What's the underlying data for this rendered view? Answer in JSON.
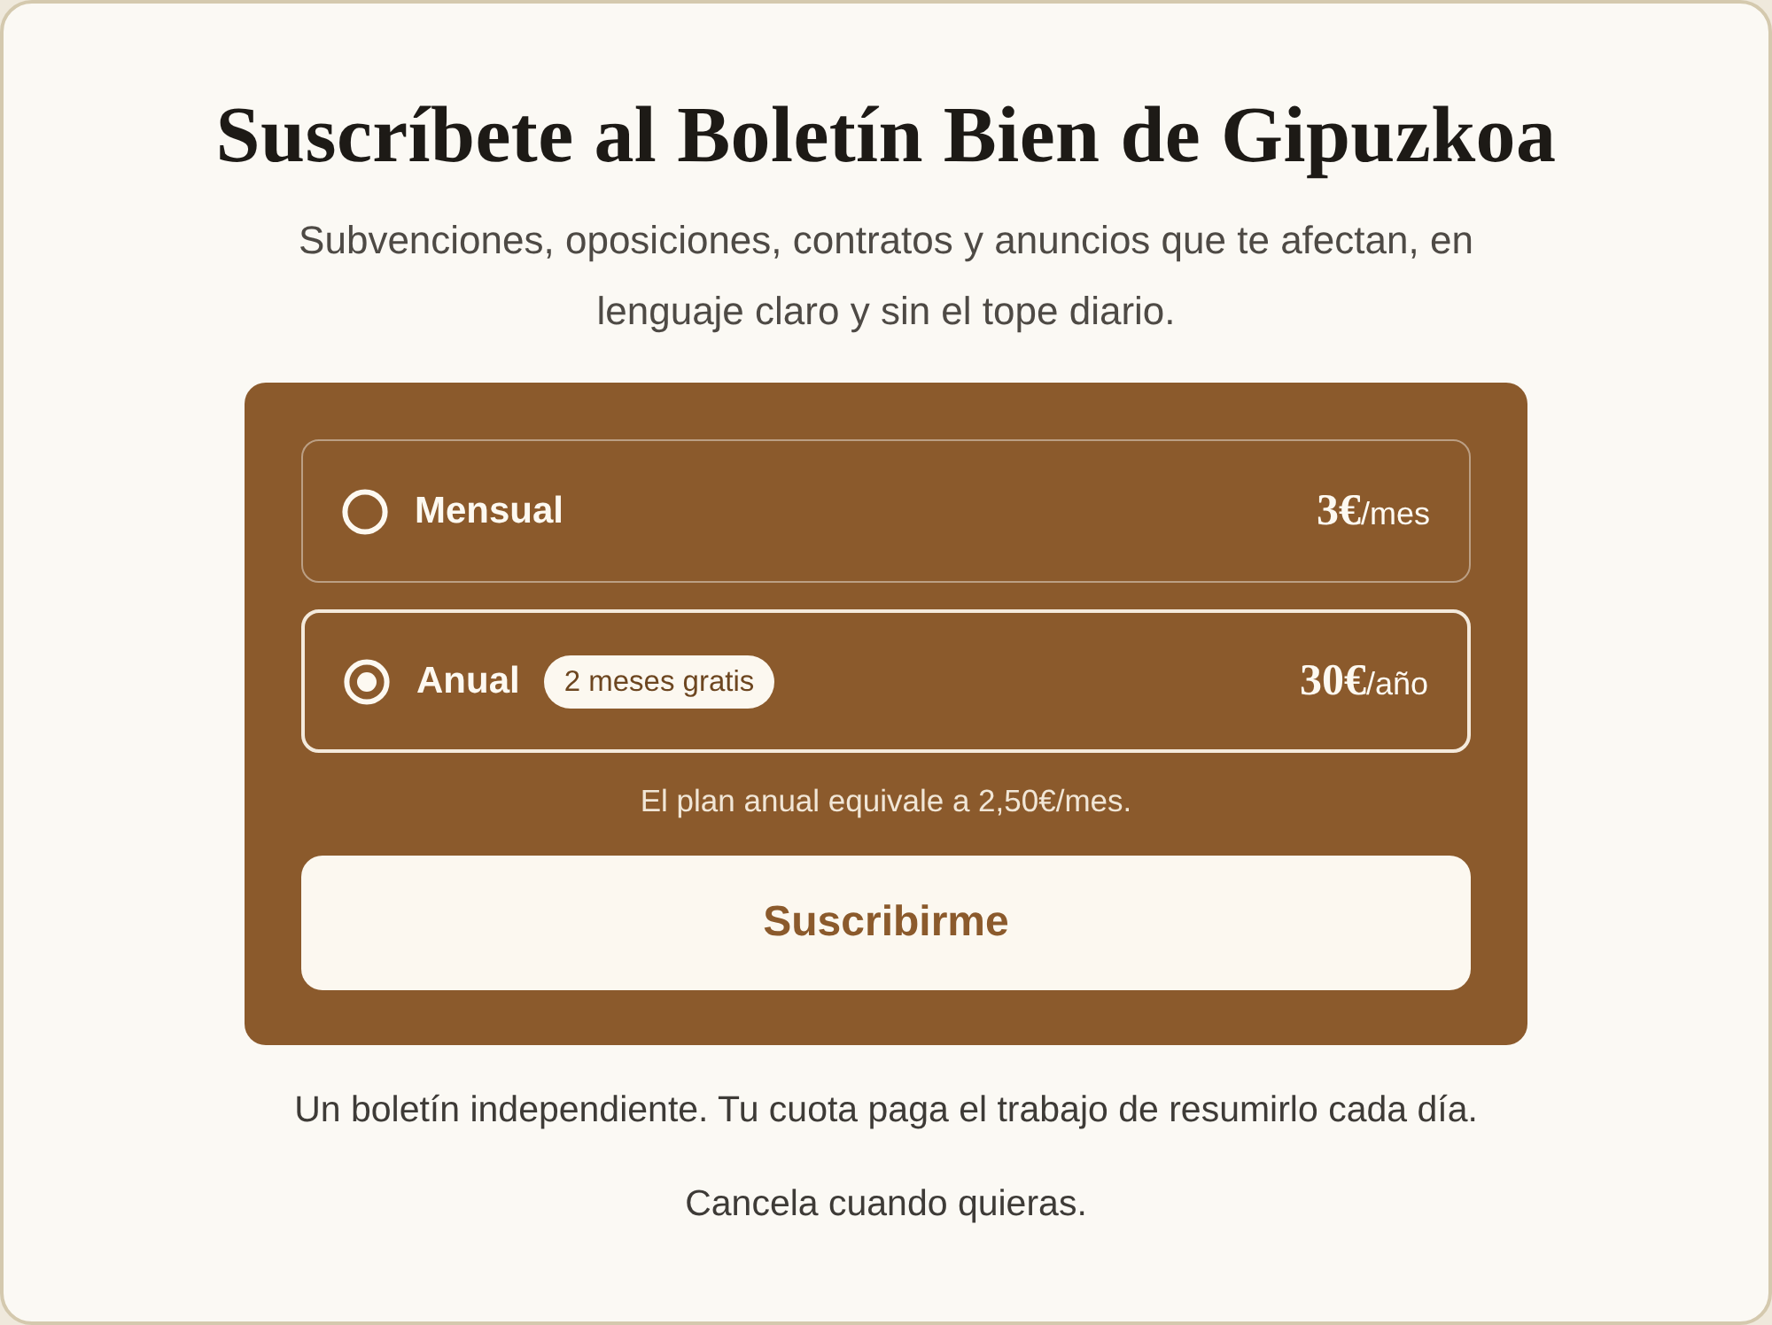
{
  "title": "Suscríbete al Boletín Bien de Gipuzkoa",
  "subtitle": "Subvenciones, oposiciones, contratos y anuncios que te afectan, en lenguaje claro y sin el tope diario.",
  "plans": [
    {
      "label": "Mensual",
      "amount": "3€",
      "period": "/mes",
      "selected": false
    },
    {
      "label": "Anual",
      "badge": "2 meses gratis",
      "amount": "30€",
      "period": "/año",
      "selected": true
    }
  ],
  "plan_note": "El plan anual equivale a 2,50€/mes.",
  "subscribe_button": "Suscribirme",
  "footer": [
    "Un boletín independiente. Tu cuota paga el trabajo de resumirlo cada día.",
    "Cancela cuando quieras."
  ]
}
